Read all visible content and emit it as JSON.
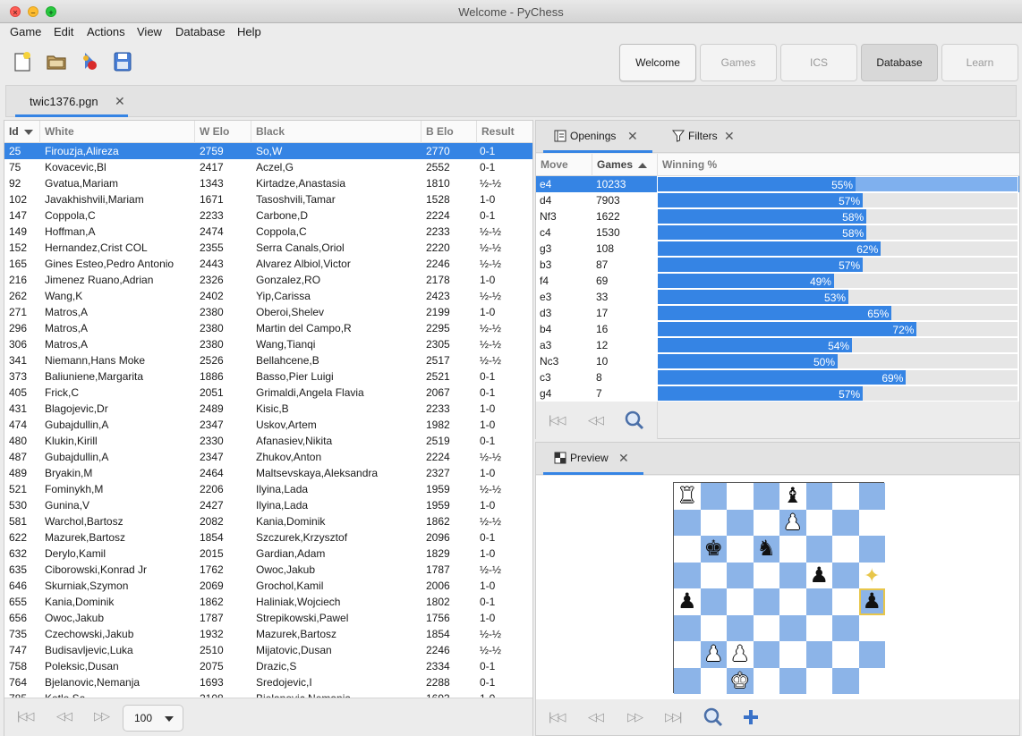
{
  "window": {
    "title": "Welcome - PyChess"
  },
  "menu": [
    "Game",
    "Edit",
    "Actions",
    "View",
    "Database",
    "Help"
  ],
  "toolbar": {
    "icons": [
      "new-game-icon",
      "open-folder-icon",
      "engines-icon",
      "save-icon"
    ],
    "perspectives": [
      {
        "label": "Welcome",
        "state": "active-light"
      },
      {
        "label": "Games",
        "state": "inactive"
      },
      {
        "label": "ICS",
        "state": "inactive"
      },
      {
        "label": "Database",
        "state": "active-dark"
      },
      {
        "label": "Learn",
        "state": "inactive"
      }
    ]
  },
  "file_tab": {
    "label": "twic1376.pgn",
    "close": "✕"
  },
  "games_table": {
    "columns": [
      "Id",
      "White",
      "W Elo",
      "Black",
      "B Elo",
      "Result"
    ],
    "selected_index": 0,
    "rows": [
      [
        "25",
        "Firouzja,Alireza",
        "2759",
        "So,W",
        "2770",
        "0-1"
      ],
      [
        "75",
        "Kovacevic,Bl",
        "2417",
        "Aczel,G",
        "2552",
        "0-1"
      ],
      [
        "92",
        "Gvatua,Mariam",
        "1343",
        "Kirtadze,Anastasia",
        "1810",
        "½-½"
      ],
      [
        "102",
        "Javakhishvili,Mariam",
        "1671",
        "Tasoshvili,Tamar",
        "1528",
        "1-0"
      ],
      [
        "147",
        "Coppola,C",
        "2233",
        "Carbone,D",
        "2224",
        "0-1"
      ],
      [
        "149",
        "Hoffman,A",
        "2474",
        "Coppola,C",
        "2233",
        "½-½"
      ],
      [
        "152",
        "Hernandez,Crist COL",
        "2355",
        "Serra Canals,Oriol",
        "2220",
        "½-½"
      ],
      [
        "165",
        "Gines Esteo,Pedro Antonio",
        "2443",
        "Alvarez Albiol,Victor",
        "2246",
        "½-½"
      ],
      [
        "216",
        "Jimenez Ruano,Adrian",
        "2326",
        "Gonzalez,RO",
        "2178",
        "1-0"
      ],
      [
        "262",
        "Wang,K",
        "2402",
        "Yip,Carissa",
        "2423",
        "½-½"
      ],
      [
        "271",
        "Matros,A",
        "2380",
        "Oberoi,Shelev",
        "2199",
        "1-0"
      ],
      [
        "296",
        "Matros,A",
        "2380",
        "Martin del Campo,R",
        "2295",
        "½-½"
      ],
      [
        "306",
        "Matros,A",
        "2380",
        "Wang,Tianqi",
        "2305",
        "½-½"
      ],
      [
        "341",
        "Niemann,Hans Moke",
        "2526",
        "Bellahcene,B",
        "2517",
        "½-½"
      ],
      [
        "373",
        "Baliuniene,Margarita",
        "1886",
        "Basso,Pier Luigi",
        "2521",
        "0-1"
      ],
      [
        "405",
        "Frick,C",
        "2051",
        "Grimaldi,Angela Flavia",
        "2067",
        "0-1"
      ],
      [
        "431",
        "Blagojevic,Dr",
        "2489",
        "Kisic,B",
        "2233",
        "1-0"
      ],
      [
        "474",
        "Gubajdullin,A",
        "2347",
        "Uskov,Artem",
        "1982",
        "1-0"
      ],
      [
        "480",
        "Klukin,Kirill",
        "2330",
        "Afanasiev,Nikita",
        "2519",
        "0-1"
      ],
      [
        "487",
        "Gubajdullin,A",
        "2347",
        "Zhukov,Anton",
        "2224",
        "½-½"
      ],
      [
        "489",
        "Bryakin,M",
        "2464",
        "Maltsevskaya,Aleksandra",
        "2327",
        "1-0"
      ],
      [
        "521",
        "Fominykh,M",
        "2206",
        "Ilyina,Lada",
        "1959",
        "½-½"
      ],
      [
        "530",
        "Gunina,V",
        "2427",
        "Ilyina,Lada",
        "1959",
        "1-0"
      ],
      [
        "581",
        "Warchol,Bartosz",
        "2082",
        "Kania,Dominik",
        "1862",
        "½-½"
      ],
      [
        "622",
        "Mazurek,Bartosz",
        "1854",
        "Szczurek,Krzysztof",
        "2096",
        "0-1"
      ],
      [
        "632",
        "Derylo,Kamil",
        "2015",
        "Gardian,Adam",
        "1829",
        "1-0"
      ],
      [
        "635",
        "Ciborowski,Konrad Jr",
        "1762",
        "Owoc,Jakub",
        "1787",
        "½-½"
      ],
      [
        "646",
        "Skurniak,Szymon",
        "2069",
        "Grochol,Kamil",
        "2006",
        "1-0"
      ],
      [
        "655",
        "Kania,Dominik",
        "1862",
        "Haliniak,Wojciech",
        "1802",
        "0-1"
      ],
      [
        "656",
        "Owoc,Jakub",
        "1787",
        "Strepikowski,Pawel",
        "1756",
        "1-0"
      ],
      [
        "735",
        "Czechowski,Jakub",
        "1932",
        "Mazurek,Bartosz",
        "1854",
        "½-½"
      ],
      [
        "747",
        "Budisavljevic,Luka",
        "2510",
        "Mijatovic,Dusan",
        "2246",
        "½-½"
      ],
      [
        "758",
        "Poleksic,Dusan",
        "2075",
        "Drazic,S",
        "2334",
        "0-1"
      ],
      [
        "764",
        "Bjelanovic,Nemanja",
        "1693",
        "Sredojevic,I",
        "2288",
        "0-1"
      ],
      [
        "785",
        "Kotlo,Sa",
        "2108",
        "Bjelanovic,Nemanja",
        "1693",
        "1-0"
      ]
    ]
  },
  "left_nav": {
    "page_size": "100"
  },
  "right_tabs": {
    "openings": "Openings",
    "filters": "Filters",
    "preview": "Preview",
    "close": "✕"
  },
  "openings_table": {
    "columns": [
      "Move",
      "Games",
      "Winning %"
    ],
    "selected_index": 0,
    "rows": [
      {
        "move": "e4",
        "games": "10233",
        "win": 55
      },
      {
        "move": "d4",
        "games": "7903",
        "win": 57
      },
      {
        "move": "Nf3",
        "games": "1622",
        "win": 58
      },
      {
        "move": "c4",
        "games": "1530",
        "win": 58
      },
      {
        "move": "g3",
        "games": "108",
        "win": 62
      },
      {
        "move": "b3",
        "games": "87",
        "win": 57
      },
      {
        "move": "f4",
        "games": "69",
        "win": 49
      },
      {
        "move": "e3",
        "games": "33",
        "win": 53
      },
      {
        "move": "d3",
        "games": "17",
        "win": 65
      },
      {
        "move": "b4",
        "games": "16",
        "win": 72
      },
      {
        "move": "a3",
        "games": "12",
        "win": 54
      },
      {
        "move": "Nc3",
        "games": "10",
        "win": 50
      },
      {
        "move": "c3",
        "games": "8",
        "win": 69
      },
      {
        "move": "g4",
        "games": "7",
        "win": 57
      }
    ]
  },
  "board": {
    "pieces": [
      {
        "sq": "a8",
        "glyph": "♜",
        "color": "white"
      },
      {
        "sq": "e8",
        "glyph": "♝",
        "color": "black"
      },
      {
        "sq": "e7",
        "glyph": "♟",
        "color": "white"
      },
      {
        "sq": "b6",
        "glyph": "♚",
        "color": "black"
      },
      {
        "sq": "d6",
        "glyph": "♞",
        "color": "black"
      },
      {
        "sq": "f5",
        "glyph": "♟",
        "color": "black"
      },
      {
        "sq": "a4",
        "glyph": "♟",
        "color": "black"
      },
      {
        "sq": "h4",
        "glyph": "♟",
        "color": "black"
      },
      {
        "sq": "b2",
        "glyph": "♟",
        "color": "white"
      },
      {
        "sq": "c2",
        "glyph": "♟",
        "color": "white"
      },
      {
        "sq": "c1",
        "glyph": "♚",
        "color": "white"
      }
    ],
    "highlight_color": "#e8c64a"
  },
  "colors": {
    "accent": "#3584e4",
    "board_dark": "#8cb4e8",
    "board_light": "#ffffff"
  }
}
